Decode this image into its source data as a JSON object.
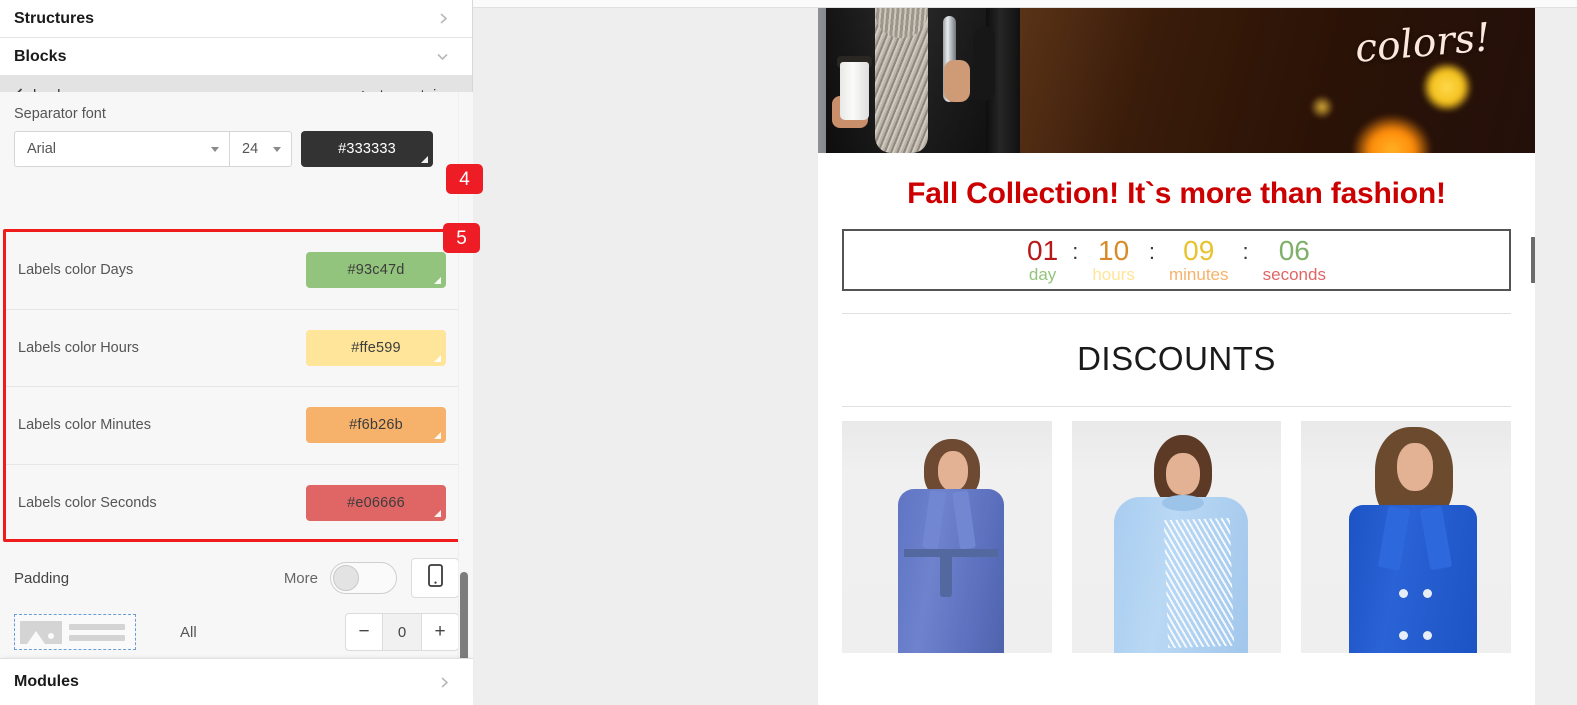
{
  "sidebar": {
    "sections": [
      {
        "label": "Structures",
        "icon": "chevron-right-icon"
      },
      {
        "label": "Blocks",
        "icon": "chevron-down-icon"
      }
    ],
    "nav": {
      "back_label": "back",
      "back_icon": "chevron-left-icon",
      "to_container_label": "to container",
      "to_container_icon": "chevron-up-icon"
    },
    "separator_font": {
      "label": "Separator font",
      "family": "Arial",
      "size": "24",
      "color": "#333333",
      "badge": "4"
    },
    "label_colors": {
      "badge": "5",
      "rows": [
        {
          "label": "Labels color Days",
          "value": "#93c47d"
        },
        {
          "label": "Labels color Hours",
          "value": "#ffe599"
        },
        {
          "label": "Labels color Minutes",
          "value": "#f6b26b"
        },
        {
          "label": "Labels color Seconds",
          "value": "#e06666"
        }
      ]
    },
    "padding": {
      "label": "Padding",
      "more_label": "More",
      "toggle_state": "off",
      "device_icon": "mobile-icon",
      "all_label": "All",
      "minus_label": "−",
      "value": "0",
      "plus_label": "+"
    },
    "modules": {
      "label": "Modules",
      "icon": "chevron-right-icon"
    }
  },
  "canvas": {
    "hero": {
      "script_text": "colors!"
    },
    "headline": "Fall Collection! It`s more than fashion!",
    "countdown": {
      "separator": ":",
      "menu_icon": "ellipsis-icon",
      "units": [
        {
          "number": "01",
          "label": "day",
          "number_color": "#b81818",
          "label_color": "#93c47d"
        },
        {
          "number": "10",
          "label": "hours",
          "number_color": "#d88a2a",
          "label_color": "#ffe599"
        },
        {
          "number": "09",
          "label": "minutes",
          "number_color": "#e8c32e",
          "label_color": "#f6b26b"
        },
        {
          "number": "06",
          "label": "seconds",
          "number_color": "#7fb069",
          "label_color": "#e06666"
        }
      ]
    },
    "discounts_title": "DISCOUNTS",
    "products": [
      {
        "alt": "woman-in-periwinkle-coat"
      },
      {
        "alt": "woman-in-light-blue-fringe-sweater"
      },
      {
        "alt": "woman-in-royal-blue-blazer"
      }
    ]
  },
  "theme": {
    "badge_red": "#ee1c25",
    "highlight_red": "#f01b1b",
    "headline_red": "#cc0000"
  }
}
